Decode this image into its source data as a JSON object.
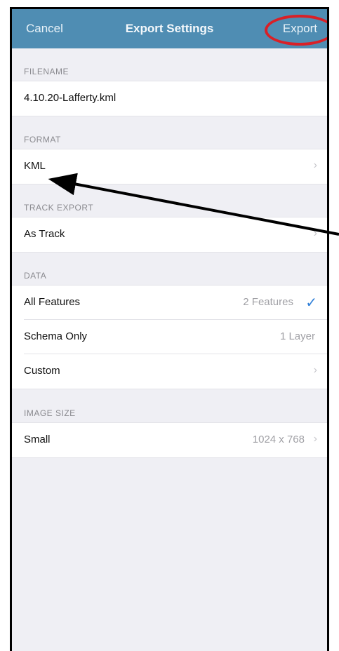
{
  "navbar": {
    "cancel_label": "Cancel",
    "title": "Export Settings",
    "export_label": "Export"
  },
  "sections": {
    "filename": {
      "header": "FILENAME",
      "value": "4.10.20-Lafferty.kml"
    },
    "format": {
      "header": "FORMAT",
      "value": "KML"
    },
    "track_export": {
      "header": "TRACK EXPORT",
      "value": "As Track"
    },
    "data": {
      "header": "DATA",
      "all_features": {
        "label": "All Features",
        "value": "2 Features"
      },
      "schema_only": {
        "label": "Schema Only",
        "value": "1 Layer"
      },
      "custom": {
        "label": "Custom"
      }
    },
    "image_size": {
      "header": "IMAGE SIZE",
      "label": "Small",
      "value": "1024 x 768"
    }
  },
  "colors": {
    "navbar": "#4f8db3",
    "highlight": "#d92027",
    "check": "#2f7fd8",
    "background": "#efeff4"
  },
  "icons": {
    "chevron": "chevron-right-icon",
    "check": "checkmark-icon",
    "arrow": "annotation-arrow"
  }
}
